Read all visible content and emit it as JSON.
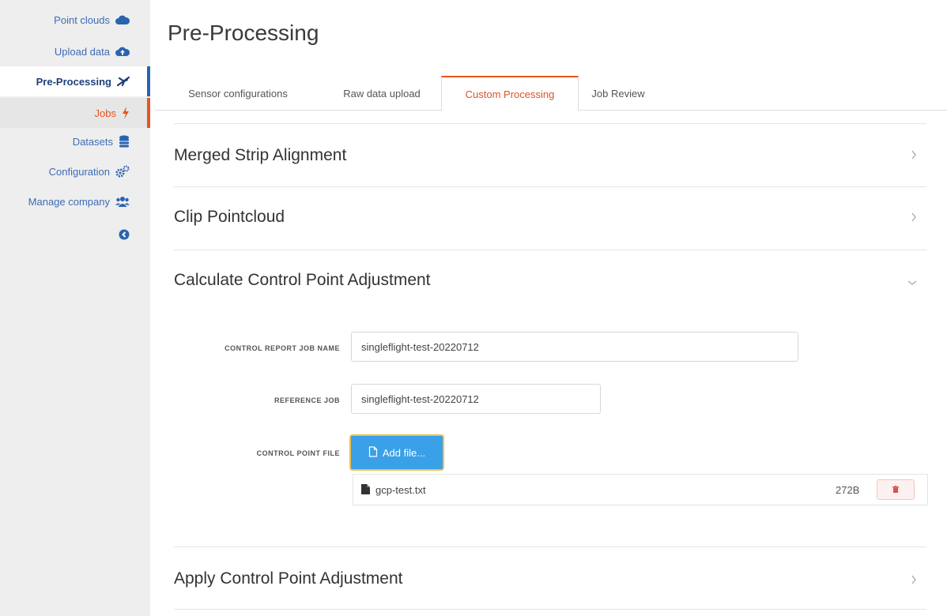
{
  "sidebar": {
    "items": [
      {
        "label": "Point clouds",
        "icon": "cloud-icon"
      },
      {
        "label": "Upload data",
        "icon": "cloud-upload-icon"
      },
      {
        "label": "Pre-Processing",
        "icon": "plane-icon"
      },
      {
        "label": "Jobs",
        "icon": "bolt-icon"
      },
      {
        "label": "Datasets",
        "icon": "database-icon"
      },
      {
        "label": "Configuration",
        "icon": "cogs-icon"
      },
      {
        "label": "Manage company",
        "icon": "users-icon"
      }
    ],
    "collapse_icon": "chevron-circle-left-icon"
  },
  "header": {
    "title": "Pre-Processing"
  },
  "tabs": [
    {
      "label": "Sensor configurations"
    },
    {
      "label": "Raw data upload"
    },
    {
      "label": "Custom Processing"
    },
    {
      "label": "Job Review"
    }
  ],
  "active_tab": "Custom Processing",
  "sections": [
    {
      "title": "Merged Strip Alignment",
      "expanded": false
    },
    {
      "title": "Clip Pointcloud",
      "expanded": false
    },
    {
      "title": "Calculate Control Point Adjustment",
      "expanded": true
    },
    {
      "title": "Apply Control Point Adjustment",
      "expanded": false
    }
  ],
  "form": {
    "job_name_label": "CONTROL REPORT JOB NAME",
    "job_name_value": "singleflight-test-20220712",
    "reference_label": "REFERENCE JOB",
    "reference_value": "singleflight-test-20220712",
    "file_label": "CONTROL POINT FILE",
    "add_file_label": "Add file...",
    "file": {
      "name": "gcp-test.txt",
      "size": "272B"
    }
  },
  "colors": {
    "accent_orange": "#e8551f",
    "link_blue": "#3c6cb3",
    "active_blue": "#2a64b0",
    "button_blue": "#3aa0e8",
    "danger_red": "#d9534f"
  }
}
